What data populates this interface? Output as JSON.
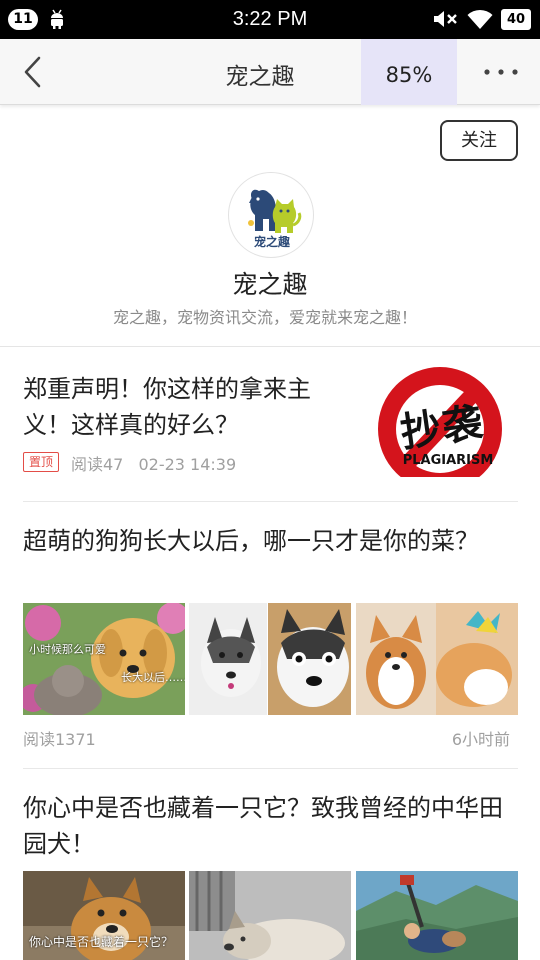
{
  "status_bar": {
    "notification_count": "11",
    "time": "3:22 PM",
    "battery": "40"
  },
  "header": {
    "title": "宠之趣",
    "zoom": "85%"
  },
  "profile": {
    "follow_label": "关注",
    "avatar_text": "宠之趣",
    "name": "宠之趣",
    "description": "宠之趣，宠物资讯交流，爱宠就来宠之趣！"
  },
  "articles": [
    {
      "title": "郑重声明！你这样的拿来主义！这样真的好么？",
      "tag": "置顶",
      "reads": "阅读47",
      "time": "02-23 14:39",
      "thumb_text_main": "抄袭",
      "thumb_text_sub": "PLAGIARISM"
    },
    {
      "title": "超萌的狗狗长大以后，哪一只才是你的菜？",
      "reads": "阅读1371",
      "time": "6小时前",
      "thumb1_caption_a": "小时候那么可爱",
      "thumb1_caption_b": "长大以后……"
    },
    {
      "title": "你心中是否也藏着一只它？致我曾经的中华田园犬！",
      "thumb1_caption": "你心中是否也藏着一只它？"
    }
  ],
  "colors": {
    "accent_tag": "#e34d47",
    "zoom_highlight": "#e6e4f8"
  }
}
